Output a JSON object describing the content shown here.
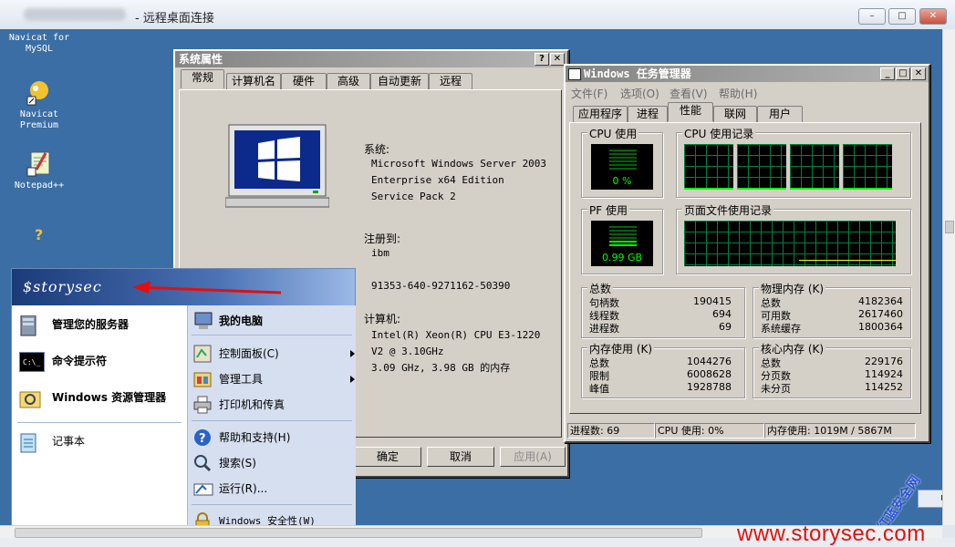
{
  "rdp": {
    "title": "- 远程桌面连接",
    "min": "–",
    "max": "□",
    "close": "✕"
  },
  "desktop_icons": [
    {
      "label": "Navicat for\nMySQL"
    },
    {
      "label": "Navicat\nPremium"
    },
    {
      "label": "Notepad++"
    }
  ],
  "sysprops": {
    "title": "系统属性",
    "help_btn": "?",
    "close_btn": "✕",
    "tabs": [
      "常规",
      "计算机名",
      "硬件",
      "高级",
      "自动更新",
      "远程"
    ],
    "system_label": "系统:",
    "system_lines": [
      "Microsoft Windows Server 2003",
      "Enterprise x64 Edition",
      "Service Pack 2"
    ],
    "registered_label": "注册到:",
    "registered_user": "ibm",
    "product_id": "91353-640-9271162-50390",
    "computer_label": "计算机:",
    "computer_lines": [
      "Intel(R) Xeon(R) CPU E3-1220",
      "V2 @ 3.10GHz",
      "3.09 GHz, 3.98 GB 的内存"
    ],
    "ok": "确定",
    "cancel": "取消",
    "apply": "应用(A)"
  },
  "taskmgr": {
    "title": "Windows 任务管理器",
    "menu": [
      "文件(F)",
      "选项(O)",
      "查看(V)",
      "帮助(H)"
    ],
    "tabs": [
      "应用程序",
      "进程",
      "性能",
      "联网",
      "用户"
    ],
    "cpu_usage_label": "CPU 使用",
    "cpu_usage_value": "0 %",
    "cpu_history_label": "CPU 使用记录",
    "pf_usage_label": "PF 使用",
    "pf_usage_value": "0.99 GB",
    "pf_history_label": "页面文件使用记录",
    "totals": {
      "label": "总数",
      "rows": [
        [
          "句柄数",
          "190415"
        ],
        [
          "线程数",
          "694"
        ],
        [
          "进程数",
          "69"
        ]
      ]
    },
    "physical": {
      "label": "物理内存 (K)",
      "rows": [
        [
          "总数",
          "4182364"
        ],
        [
          "可用数",
          "2617460"
        ],
        [
          "系统缓存",
          "1800364"
        ]
      ]
    },
    "commit": {
      "label": "内存使用 (K)",
      "rows": [
        [
          "总数",
          "1044276"
        ],
        [
          "限制",
          "6008628"
        ],
        [
          "峰值",
          "1928788"
        ]
      ]
    },
    "kernel": {
      "label": "核心内存 (K)",
      "rows": [
        [
          "总数",
          "229176"
        ],
        [
          "分页数",
          "114924"
        ],
        [
          "未分页",
          "114252"
        ]
      ]
    },
    "status": [
      "进程数: 69",
      "CPU 使用: 0%",
      "内存使用: 1019M / 5867M"
    ]
  },
  "start_menu": {
    "user": "$storysec",
    "left_items": [
      "管理您的服务器",
      "命令提示符",
      "Windows 资源管理器",
      "记事本"
    ],
    "right_items": [
      "我的电脑",
      "控制面板(C)",
      "管理工具",
      "打印机和传真",
      "帮助和支持(H)",
      "搜索(S)",
      "运行(R)...",
      "Windows 安全性(W)"
    ]
  },
  "tray": {
    "ime": "中"
  },
  "watermark": {
    "url": "www.storysec.com",
    "tag": "红蓝安全网"
  },
  "colors": {
    "desktop": "#3a6ea5",
    "classic": "#d4d0c8",
    "graph_green": "#00ff00",
    "grid_green": "#008040",
    "accent_red": "#e01010"
  }
}
